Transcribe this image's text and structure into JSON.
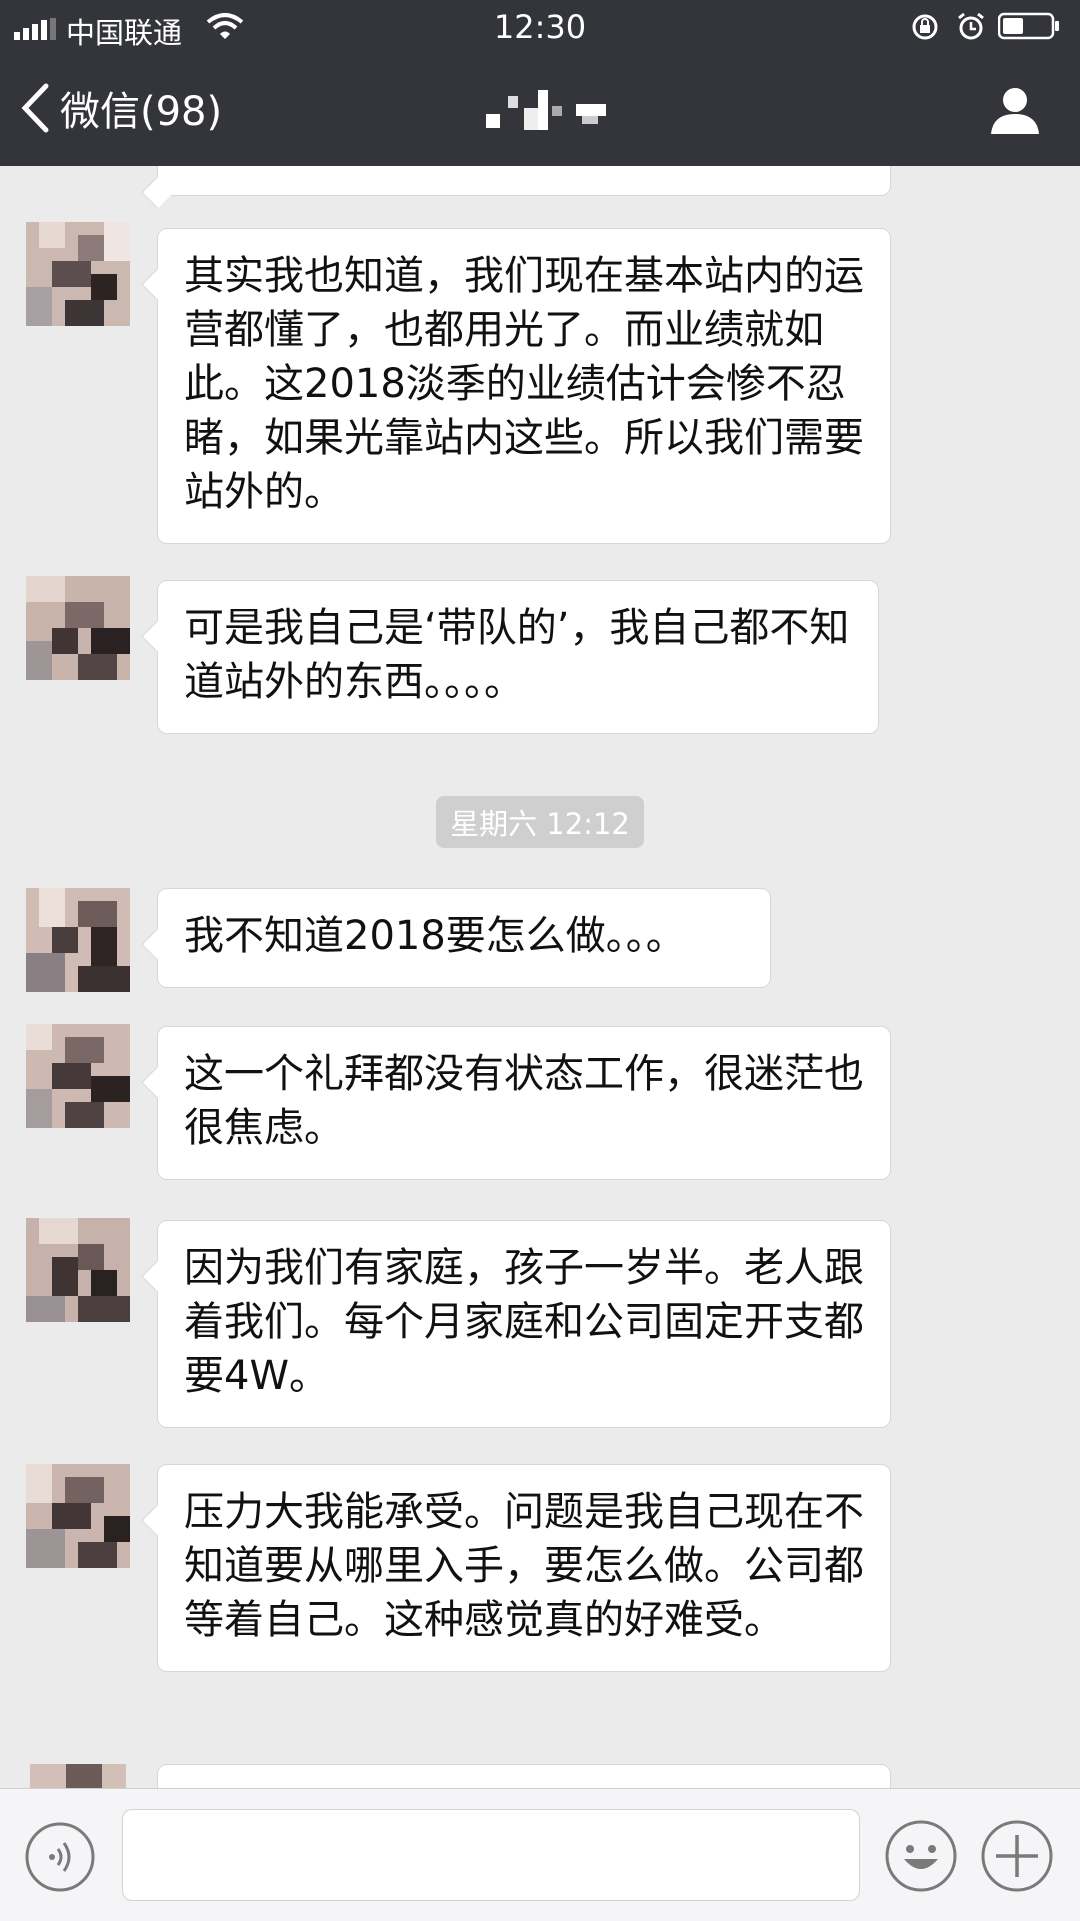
{
  "status_bar": {
    "carrier": "中国联通",
    "time": "12:30",
    "icons": [
      "signal-icon",
      "wifi-icon",
      "rotation-lock-icon",
      "alarm-icon",
      "battery-icon"
    ]
  },
  "nav": {
    "back_label": "微信(98)",
    "title": "",
    "icons": [
      "chevron-left-icon",
      "profile-icon"
    ]
  },
  "chat": {
    "messages": [
      {
        "text": "其实我也知道，我们现在基本站内的运营都懂了，也都用光了。而业绩就如此。这2018淡季的业绩估计会惨不忍睹，如果光靠站内这些。所以我们需要站外的。"
      },
      {
        "text": "可是我自己是‘带队的’，我自己都不知道站外的东西。。。。"
      },
      {
        "text": "我不知道2018要怎么做。。。"
      },
      {
        "text": "这一个礼拜都没有状态工作，很迷茫也很焦虑。"
      },
      {
        "text": "因为我们有家庭，孩子一岁半。老人跟着我们。每个月家庭和公司固定开支都要4W。"
      },
      {
        "text": "压力大我能承受。问题是我自己现在不知道要从哪里入手，要怎么做。公司都等着自己。这种感觉真的好难受。"
      }
    ],
    "timestamp": "星期六 12:12"
  },
  "input_bar": {
    "icons": [
      "voice-icon",
      "emoji-icon",
      "plus-icon"
    ]
  },
  "colors": {
    "nav_bg": "#33353a",
    "chat_bg": "#ebebeb",
    "bubble_bg": "#ffffff",
    "timestamp_bg": "#cfcfcf"
  }
}
